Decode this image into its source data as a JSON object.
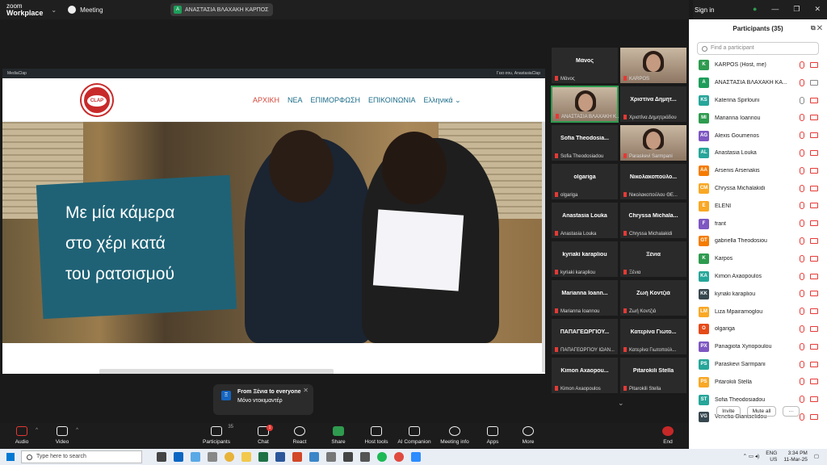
{
  "app": {
    "logo_line1": "zoom",
    "logo_line2": "Workplace",
    "meeting_label": "Meeting",
    "pill_text": "ΑΝΑΣΤΑΣΙΑ ΒΛΑΧΑΚΗ ΚΑΡΠΟΣ",
    "pill_avatar": "A",
    "sign_in": "Sign in"
  },
  "browser": {
    "site": "MediaClap",
    "greeting": "Γεια σου, AnastasiaClap",
    "logo_text": "CLAP",
    "menu": [
      "ΑΡΧΙΚΗ",
      "ΝΕΑ",
      "ΕΠΙΜΟΡΦΩΣΗ",
      "ΕΠΙΚΟΙΝΩΝΙΑ",
      "Ελληνικά ⌄"
    ],
    "hero_lines": [
      "Με μία κάμερα",
      "στο χέρι κατά",
      "του ρατσισμού"
    ]
  },
  "chat_popup": {
    "icon": "Ξ",
    "title": "From Ξένια to everyone",
    "message": "Μόνο ντοκιμαντέρ"
  },
  "gallery": [
    {
      "name": "Μάνος",
      "sub": "Μάνος",
      "photo": false
    },
    {
      "name": "",
      "sub": "KARPOS",
      "photo": true
    },
    {
      "name": "",
      "sub": "ΑΝΑΣΤΑΣΙΑ ΒΛΑΧΑΚΗ Κ...",
      "photo": true
    },
    {
      "name": "Χριστίνα Δημητ...",
      "sub": "Χριστίνα Δημητριάδου",
      "photo": false
    },
    {
      "name": "Sofia Theodosia...",
      "sub": "Sofia Theodosiadou",
      "photo": false
    },
    {
      "name": "",
      "sub": "Paraskevi Sarmpani",
      "photo": true
    },
    {
      "name": "olgariga",
      "sub": "olgariga",
      "photo": false
    },
    {
      "name": "Νικολακοπούλο...",
      "sub": "Νικολακοπούλου ΘΕ...",
      "photo": false
    },
    {
      "name": "Anastasia Louka",
      "sub": "Anastasia Louka",
      "photo": false
    },
    {
      "name": "Chryssa Michala...",
      "sub": "Chryssa Michalakidi",
      "photo": false
    },
    {
      "name": "kyriaki karapliou",
      "sub": "kyriaki karapliou",
      "photo": false
    },
    {
      "name": "Ξένια",
      "sub": "Ξένια",
      "photo": false
    },
    {
      "name": "Marianna Ioann...",
      "sub": "Marianna Ioannou",
      "photo": false
    },
    {
      "name": "Ζωή Κοντζιά",
      "sub": "Ζωή Κοντζιά",
      "photo": false
    },
    {
      "name": "ΠΑΠΑΓΕΩΡΓΙΟΥ...",
      "sub": "ΠΑΠΑΓΕΩΡΓΙΟΥ ΙΩΑΝ...",
      "photo": false
    },
    {
      "name": "Κατερίνα Γιωτο...",
      "sub": "Κατερίνα Γιωτοπούλ...",
      "photo": false
    },
    {
      "name": "Kimon Axaopou...",
      "sub": "Kimon Axaopoulos",
      "photo": false
    },
    {
      "name": "Pitarokili Stella",
      "sub": "Pitarokili Stella",
      "photo": false
    }
  ],
  "participants": {
    "title": "Participants (35)",
    "search_placeholder": "Find a participant",
    "invite": "Invite",
    "mute_all": "Mute all",
    "list": [
      {
        "initials": "K",
        "name": "KARPOS (Host, me)",
        "color": "#2e9b4f",
        "mic": false,
        "cam": false
      },
      {
        "initials": "A",
        "name": "ΑΝΑΣΤΑΣΙΑ ΒΛΑΧΑΚΗ ΚΑ...",
        "color": "#1e9e5a",
        "mic": false,
        "cam": true
      },
      {
        "initials": "KS",
        "name": "Katerina Spirlouni",
        "color": "#26a69a",
        "mic": true,
        "cam": false
      },
      {
        "initials": "MI",
        "name": "Marianna Ioannou",
        "color": "#2e9b4f",
        "mic": false,
        "cam": false
      },
      {
        "initials": "AG",
        "name": "Alexis Goumenos",
        "color": "#7e57c2",
        "mic": false,
        "cam": false
      },
      {
        "initials": "AL",
        "name": "Anastasia Louka",
        "color": "#26a69a",
        "mic": false,
        "cam": false
      },
      {
        "initials": "AA",
        "name": "Arsenis Arsenakis",
        "color": "#f57c00",
        "mic": false,
        "cam": false
      },
      {
        "initials": "CM",
        "name": "Chryssa Michalakidi",
        "color": "#f9a825",
        "mic": false,
        "cam": false
      },
      {
        "initials": "E",
        "name": "ELENI",
        "color": "#f9a825",
        "mic": false,
        "cam": false
      },
      {
        "initials": "F",
        "name": "frant",
        "color": "#7e57c2",
        "mic": false,
        "cam": false
      },
      {
        "initials": "GT",
        "name": "gabriella Theodosiou",
        "color": "#f57c00",
        "mic": false,
        "cam": false
      },
      {
        "initials": "K",
        "name": "Karpos",
        "color": "#2e9b4f",
        "mic": false,
        "cam": false
      },
      {
        "initials": "KA",
        "name": "Kimon Axaopoulos",
        "color": "#26a69a",
        "mic": false,
        "cam": false
      },
      {
        "initials": "KK",
        "name": "kyriaki karapliou",
        "color": "#37474f",
        "mic": false,
        "cam": false
      },
      {
        "initials": "LM",
        "name": "Liza Mpairamoglou",
        "color": "#f9a825",
        "mic": false,
        "cam": false
      },
      {
        "initials": "O",
        "name": "olgariga",
        "color": "#e64a19",
        "mic": false,
        "cam": false
      },
      {
        "initials": "PX",
        "name": "Panagiota Xyriopoulou",
        "color": "#7e57c2",
        "mic": false,
        "cam": false
      },
      {
        "initials": "PS",
        "name": "Paraskevi Sarmpani",
        "color": "#26a69a",
        "mic": false,
        "cam": false
      },
      {
        "initials": "PS",
        "name": "Pitarokili Stella",
        "color": "#f9a825",
        "mic": false,
        "cam": false
      },
      {
        "initials": "ST",
        "name": "Sofia Theodosiadou",
        "color": "#26a69a",
        "mic": false,
        "cam": false
      },
      {
        "initials": "VG",
        "name": "Venetia Giantselidou",
        "color": "#37474f",
        "mic": false,
        "cam": false
      }
    ]
  },
  "toolbar": {
    "audio": "Audio",
    "video": "Video",
    "participants": "Participants",
    "participants_count": "35",
    "chat": "Chat",
    "chat_badge": "1",
    "react": "React",
    "share": "Share",
    "host_tools": "Host tools",
    "ai": "AI Companion",
    "meeting_info": "Meeting info",
    "apps": "Apps",
    "more": "More",
    "end": "End"
  },
  "taskbar": {
    "search": "Type here to search",
    "lang1": "ENG",
    "lang2": "US",
    "time": "3:34 PM",
    "date": "11-Mar-25"
  }
}
